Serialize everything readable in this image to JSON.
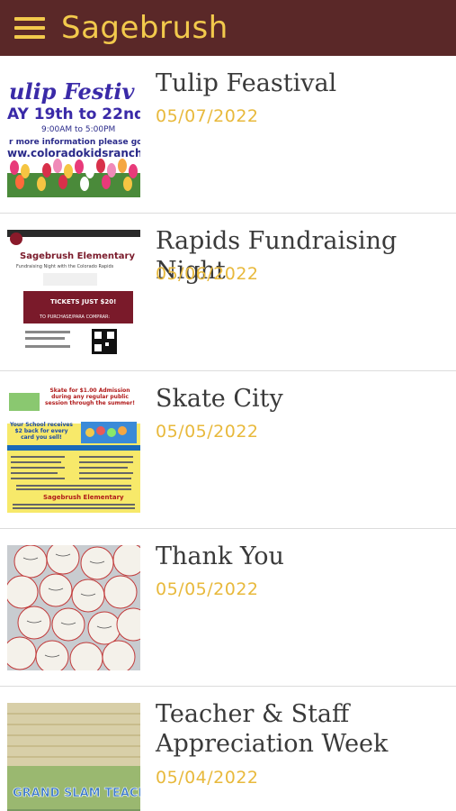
{
  "app": {
    "title": "Sagebrush",
    "colors": {
      "header_bg": "#5a2828",
      "accent": "#f2c94c",
      "date": "#e8b93c"
    },
    "menu_icon": "hamburger-menu-icon"
  },
  "feed": {
    "items": [
      {
        "title": "Tulip Feastival",
        "date": "05/07/2022",
        "thumb": {
          "headline": "ulip Festiv",
          "dates": "AY 19th to 22nd",
          "time": "9:00AM to 5:00PM",
          "info": "r more information please go t",
          "url": "ww.coloradokidsranch.c"
        }
      },
      {
        "title": "Rapids Fundraising Night",
        "date": "05/06/2022",
        "thumb": {
          "school": "Sagebrush Elementary",
          "sub": "Fundraising Night with the Colorado Rapids",
          "tickets": "TICKETS JUST $20!",
          "purchase": "TO PURCHASE/PARA COMPRAR:"
        }
      },
      {
        "title": "Skate City",
        "date": "05/05/2022",
        "thumb": {
          "headline": "Skate for $1.00 Admission during any regular public session through the summer!",
          "school_line": "Your School receives $2 back for every card you sell!",
          "footer": "Sagebrush Elementary"
        }
      },
      {
        "title": "Thank You",
        "date": "05/05/2022",
        "thumb": {
          "subject": "baseballs"
        }
      },
      {
        "title": "Teacher & Staff Appreciation Week",
        "date": "05/04/2022",
        "thumb": {
          "sign": "GRAND SLAM TEACHERS & STA"
        }
      }
    ]
  }
}
